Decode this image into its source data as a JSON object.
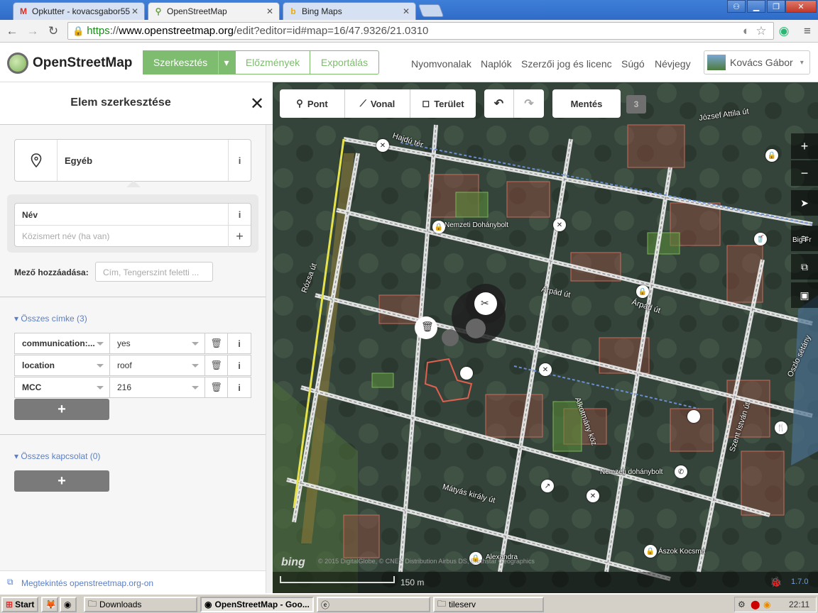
{
  "browser": {
    "tabs": [
      {
        "title": "Opkutter - kovacsgabor55@",
        "icon": "gmail-icon"
      },
      {
        "title": "OpenStreetMap",
        "icon": "osm-icon"
      },
      {
        "title": "Bing Maps",
        "icon": "bing-icon"
      }
    ],
    "url": {
      "scheme": "https",
      "sep": "://",
      "host": "www.openstreetmap.org",
      "rest": "/edit?editor=id#map=16/47.9326/21.0310"
    }
  },
  "osm": {
    "site_name": "OpenStreetMap",
    "edit_btn": "Szerkesztés",
    "history_btn": "Előzmények",
    "export_btn": "Exportálás",
    "nav": [
      "Nyomvonalak",
      "Naplók",
      "Szerzői jog és licenc",
      "Súgó",
      "Névjegy"
    ],
    "user": "Kovács Gábor"
  },
  "sidebar": {
    "title": "Elem szerkesztése",
    "preset": "Egyéb",
    "name_label": "Név",
    "name_placeholder": "Közismert név (ha van)",
    "add_field_label": "Mező hozzáadása:",
    "add_field_placeholder": "Cím, Tengerszint feletti ...",
    "tags_header": "Összes címke (3)",
    "tags": [
      {
        "key": "communication:...",
        "value": "yes"
      },
      {
        "key": "location",
        "value": "roof"
      },
      {
        "key": "MCC",
        "value": "216"
      }
    ],
    "relations_header": "Összes kapcsolat (0)",
    "view_link": "Megtekintés openstreetmap.org-on"
  },
  "map": {
    "tools": {
      "point": "Pont",
      "line": "Vonal",
      "area": "Terület",
      "save": "Mentés",
      "count": "3"
    },
    "labels": [
      {
        "text": "József Attila út"
      },
      {
        "text": "Hajdú tér"
      },
      {
        "text": "Nemzeti Dohánybolt"
      },
      {
        "text": "Big Fr"
      },
      {
        "text": "Árpád út"
      },
      {
        "text": "Árpád út"
      },
      {
        "text": "Rózsa út"
      },
      {
        "text": "Szent István út"
      },
      {
        "text": "Alkotmány köz"
      },
      {
        "text": "Nemzeti dohánybolt"
      },
      {
        "text": "Mátyás király út"
      },
      {
        "text": "Alexandra"
      },
      {
        "text": "Ászok Kocsma"
      },
      {
        "text": "Oszlo sétány"
      }
    ],
    "scale": "150 m",
    "bing": "bing",
    "attribution": "© 2015 DigitalGlobe, © CNES Distribution Airbus DS, Earthstar Geographics",
    "version": "1.7.0"
  },
  "taskbar": {
    "start": "Start",
    "items": [
      "Downloads",
      "OpenStreetMap - Goo...",
      "tileserv"
    ],
    "clock": "22:11"
  },
  "colors": {
    "osm_green": "#7ebc6f",
    "link_blue": "#5a7fc7"
  }
}
